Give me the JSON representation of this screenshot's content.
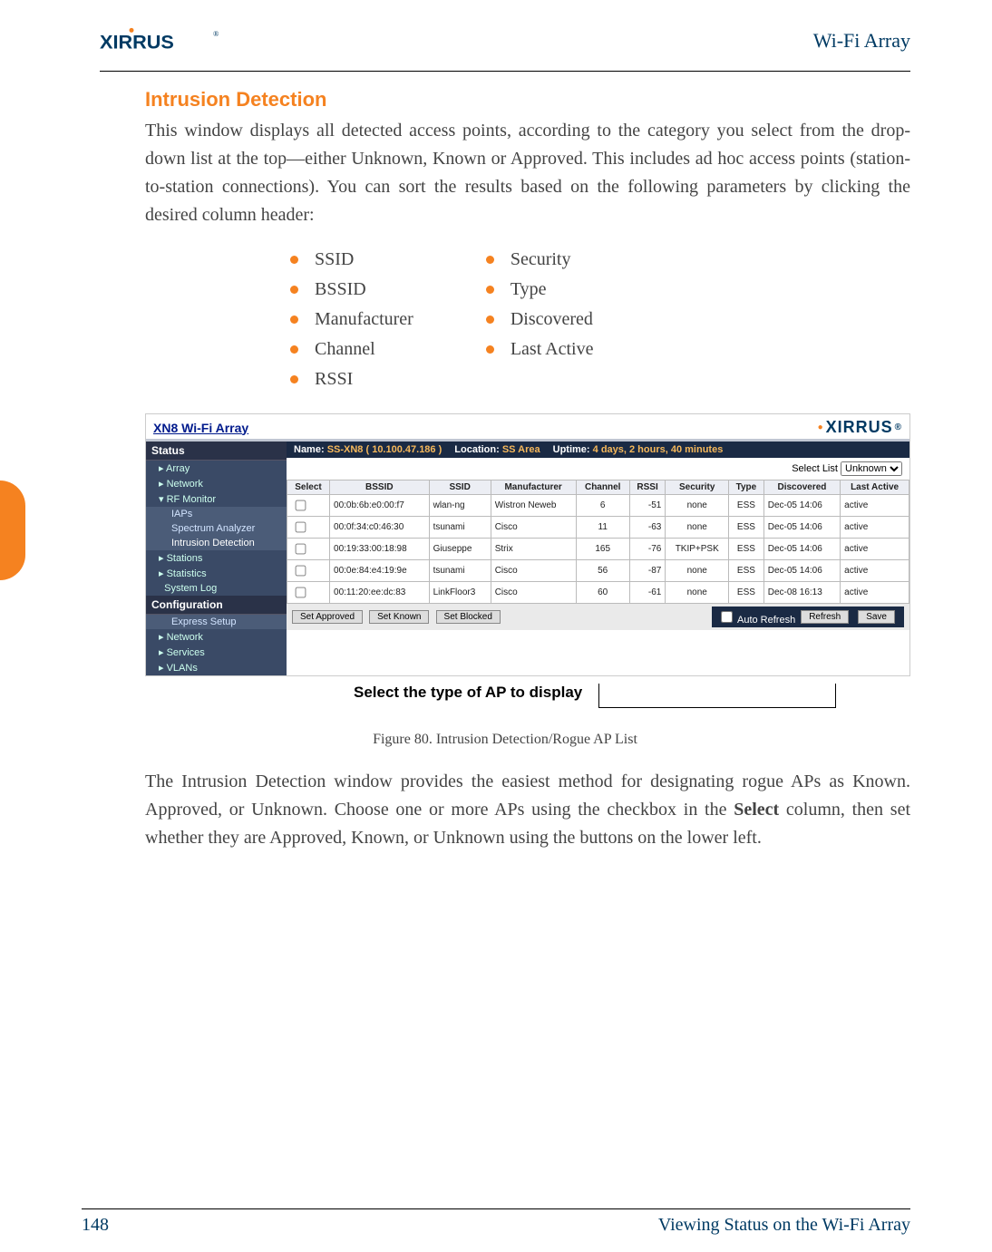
{
  "header": {
    "brand": "XIRRUS",
    "title": "Wi-Fi Array"
  },
  "section": {
    "heading": "Intrusion Detection",
    "para1": "This window displays all detected access points, according to the category you select from the drop-down list at the top—either Unknown, Known or Approved. This includes ad hoc access points (station-to-station connections). You can sort the results based on the following parameters by clicking the desired column header:",
    "bullets_left": [
      "SSID",
      "BSSID",
      "Manufacturer",
      "Channel",
      "RSSI"
    ],
    "bullets_right": [
      "Security",
      "Type",
      "Discovered",
      "Last Active"
    ]
  },
  "screenshot": {
    "banner_title": "XN8 Wi-Fi Array",
    "brand": "XIRRUS",
    "info": {
      "name_label": "Name:",
      "name_value": "SS-XN8   ( 10.100.47.186 )",
      "location_label": "Location:",
      "location_value": "SS Area",
      "uptime_label": "Uptime:",
      "uptime_value": "4 days, 2 hours, 40 minutes"
    },
    "sidebar": {
      "status": "Status",
      "items_top": [
        "Array",
        "Network",
        "RF Monitor"
      ],
      "subs": [
        "IAPs",
        "Spectrum Analyzer",
        "Intrusion Detection"
      ],
      "items_mid": [
        "Stations",
        "Statistics",
        "System Log"
      ],
      "config": "Configuration",
      "items_cfg": [
        "Express Setup",
        "Network",
        "Services",
        "VLANs"
      ]
    },
    "select_list_label": "Select List",
    "select_list_value": "Unknown",
    "table": {
      "headers": [
        "Select",
        "BSSID",
        "SSID",
        "Manufacturer",
        "Channel",
        "RSSI",
        "Security",
        "Type",
        "Discovered",
        "Last Active"
      ],
      "rows": [
        {
          "bssid": "00:0b:6b:e0:00:f7",
          "ssid": "wlan-ng",
          "mfr": "Wistron Neweb",
          "ch": "6",
          "rssi": "-51",
          "sec": "none",
          "type": "ESS",
          "disc": "Dec-05 14:06",
          "last": "active"
        },
        {
          "bssid": "00:0f:34:c0:46:30",
          "ssid": "tsunami",
          "mfr": "Cisco",
          "ch": "11",
          "rssi": "-63",
          "sec": "none",
          "type": "ESS",
          "disc": "Dec-05 14:06",
          "last": "active"
        },
        {
          "bssid": "00:19:33:00:18:98",
          "ssid": "Giuseppe",
          "mfr": "Strix",
          "ch": "165",
          "rssi": "-76",
          "sec": "TKIP+PSK",
          "type": "ESS",
          "disc": "Dec-05 14:06",
          "last": "active"
        },
        {
          "bssid": "00:0e:84:e4:19:9e",
          "ssid": "tsunami",
          "mfr": "Cisco",
          "ch": "56",
          "rssi": "-87",
          "sec": "none",
          "type": "ESS",
          "disc": "Dec-05 14:06",
          "last": "active"
        },
        {
          "bssid": "00:11:20:ee:dc:83",
          "ssid": "LinkFloor3",
          "mfr": "Cisco",
          "ch": "60",
          "rssi": "-61",
          "sec": "none",
          "type": "ESS",
          "disc": "Dec-08 16:13",
          "last": "active"
        }
      ]
    },
    "buttons": {
      "approved": "Set Approved",
      "known": "Set Known",
      "blocked": "Set Blocked",
      "auto": "Auto Refresh",
      "refresh": "Refresh",
      "save": "Save"
    }
  },
  "callout": "Select the type of AP to display",
  "figure_caption": "Figure 80. Intrusion Detection/Rogue AP List",
  "para2_parts": {
    "a": "The Intrusion Detection window provides the easiest method for designating rogue APs as Known. Approved, or Unknown. Choose one or more APs using the checkbox in the ",
    "b": "Select",
    "c": " column, then set whether they are Approved, Known, or Unknown using the buttons on the lower left."
  },
  "footer": {
    "page": "148",
    "title": "Viewing Status on the Wi-Fi Array"
  }
}
